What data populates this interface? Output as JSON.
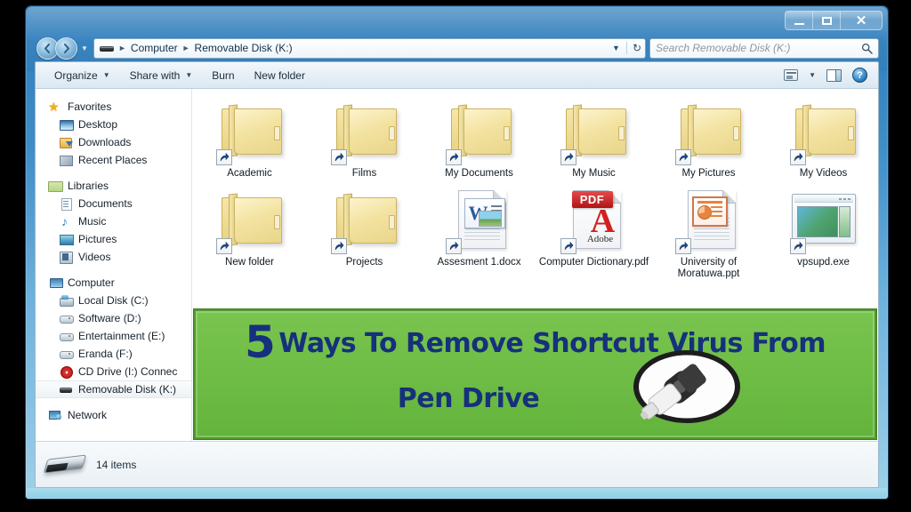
{
  "window": {
    "caption_buttons": [
      {
        "name": "minimize",
        "label": "–"
      },
      {
        "name": "maximize",
        "label": "□"
      },
      {
        "name": "close",
        "label": "✕"
      }
    ]
  },
  "addressbar": {
    "back_label": "◄",
    "forward_label": "►",
    "history_caret": "▼",
    "drive_icon": "removable-drive-icon",
    "crumbs": [
      "Computer",
      "Removable Disk (K:)"
    ],
    "separator": "►",
    "dropdown_caret": "▼",
    "refresh_label": "↻"
  },
  "search": {
    "placeholder": "Search Removable Disk (K:)",
    "value": "",
    "icon": "search-icon"
  },
  "commandbar": {
    "items": [
      {
        "label": "Organize",
        "caret": "▼"
      },
      {
        "label": "Share with",
        "caret": "▼"
      },
      {
        "label": "Burn",
        "caret": ""
      },
      {
        "label": "New folder",
        "caret": ""
      }
    ],
    "view_caret": "▼",
    "help_label": "?"
  },
  "navpane": {
    "groups": [
      {
        "header": {
          "label": "Favorites",
          "icon": "star-icon",
          "icon_class": "ic-star"
        },
        "items": [
          {
            "label": "Desktop",
            "icon": "desktop-icon",
            "icon_class": "ic-desktop"
          },
          {
            "label": "Downloads",
            "icon": "downloads-icon",
            "icon_class": "ic-downloads"
          },
          {
            "label": "Recent Places",
            "icon": "recent-places-icon",
            "icon_class": "ic-recent"
          }
        ]
      },
      {
        "header": {
          "label": "Libraries",
          "icon": "libraries-icon",
          "icon_class": "ic-libraries"
        },
        "items": [
          {
            "label": "Documents",
            "icon": "documents-icon",
            "icon_class": "ic-documents"
          },
          {
            "label": "Music",
            "icon": "music-icon",
            "icon_class": "ic-music"
          },
          {
            "label": "Pictures",
            "icon": "pictures-icon",
            "icon_class": "ic-pictures"
          },
          {
            "label": "Videos",
            "icon": "videos-icon",
            "icon_class": "ic-videos"
          }
        ]
      },
      {
        "header": {
          "label": "Computer",
          "icon": "computer-icon",
          "icon_class": "ic-computer"
        },
        "items": [
          {
            "label": "Local Disk (C:)",
            "icon": "local-disk-icon",
            "icon_class": "ic-localdisk"
          },
          {
            "label": "Software (D:)",
            "icon": "drive-icon",
            "icon_class": "ic-drive"
          },
          {
            "label": "Entertainment (E:)",
            "icon": "drive-icon",
            "icon_class": "ic-drive"
          },
          {
            "label": "Eranda (F:)",
            "icon": "drive-icon",
            "icon_class": "ic-drive"
          },
          {
            "label": "CD Drive (I:) Connec",
            "icon": "cd-drive-icon",
            "icon_class": "ic-cd"
          },
          {
            "label": "Removable Disk (K:)",
            "icon": "usb-drive-icon",
            "icon_class": "ic-usb",
            "selected": true
          }
        ]
      },
      {
        "header": {
          "label": "Network",
          "icon": "network-icon",
          "icon_class": "ic-network"
        },
        "items": []
      }
    ]
  },
  "files": {
    "row1": [
      {
        "label": "Academic",
        "kind": "folder",
        "shortcut": true
      },
      {
        "label": "Films",
        "kind": "folder",
        "shortcut": true
      },
      {
        "label": "My Documents",
        "kind": "folder",
        "shortcut": true
      },
      {
        "label": "My Music",
        "kind": "folder",
        "shortcut": true
      },
      {
        "label": "My Pictures",
        "kind": "folder",
        "shortcut": true
      },
      {
        "label": "My Videos",
        "kind": "folder",
        "shortcut": true
      }
    ],
    "row2": [
      {
        "label": "New folder",
        "kind": "folder",
        "shortcut": true
      },
      {
        "label": "Projects",
        "kind": "folder",
        "shortcut": true
      },
      {
        "label": "Assesment 1.docx",
        "kind": "word",
        "shortcut": true,
        "badge": "W"
      },
      {
        "label": "Computer Dictionary.pdf",
        "kind": "pdf",
        "shortcut": true,
        "badge": "PDF",
        "badge2": "Adobe",
        "badge3": "A"
      },
      {
        "label": "University of Moratuwa.ppt",
        "kind": "ppt",
        "shortcut": true
      },
      {
        "label": "vpsupd.exe",
        "kind": "exe",
        "shortcut": true
      }
    ]
  },
  "banner": {
    "number": "5",
    "line1": "Ways To Remove Shortcut Virus From",
    "line2": "Pen Drive",
    "green": "#6fbd46",
    "text_color": "#16307c",
    "usb_icon": "usb-pen-drive-icon"
  },
  "statusbar": {
    "item_count": "14 items",
    "drive_icon": "removable-drive-icon"
  }
}
